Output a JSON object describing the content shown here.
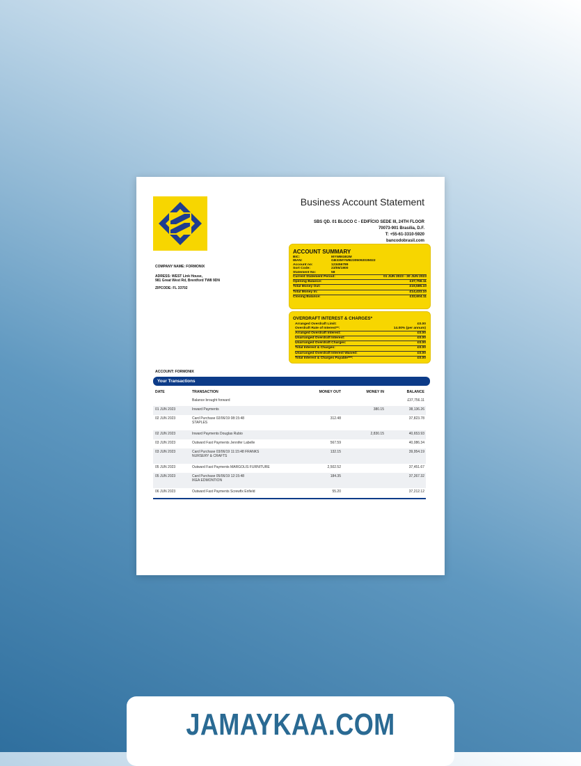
{
  "statement": {
    "title": "Business Account Statement",
    "bank_address": [
      "SBS QD. 01 BLOCO C - EDIFÍCIO SEDE III, 24TH FLOOR",
      "70073-901 Brasília, D.F.",
      "T: +55-61-3310-5920",
      "bancodobrasil.com"
    ],
    "company_name": "COMPANY NAME: FORMONIX",
    "address_line1": "ADRESS: WEST Link House,",
    "address_line2": "981 Great West Rd, Brentford TW8 9DN",
    "zipcode": "ZIPCODE: FL 33702",
    "brand_color": "#f7d600",
    "accent_color": "#0c3b88"
  },
  "summary": {
    "title": "ACCOUNT SUMMARY",
    "details": [
      {
        "label": "BIC:",
        "value": "MYWBGB2M"
      },
      {
        "label": "IBAN:",
        "value": "GB33MYWB2305092035022"
      },
      {
        "label": "Account no:",
        "value": "123456789"
      },
      {
        "label": "Sort Code:",
        "value": "23/05/1900"
      },
      {
        "label": "Statement No:",
        "value": "58"
      }
    ],
    "lines": [
      {
        "label": "Current Statement Period:",
        "value": "01 JUN 2023 - 30 JUN 2023"
      },
      {
        "label": "Opening Balance:",
        "value": "£37,756.11"
      },
      {
        "label": "Total Money Out:",
        "value": "£19,585.10"
      },
      {
        "label": "Total Money In:",
        "value": "£14,433.10"
      },
      {
        "label": "Closing Balance:",
        "value": "£32,604.11"
      }
    ]
  },
  "overdraft": {
    "title": "OVERDRAFT INTEREST & CHARGES*",
    "lines": [
      {
        "label": "Arranged Overdraft Limit:",
        "value": "£0.00"
      },
      {
        "label": "Overdraft Rate of Interest**:",
        "value": "14.00% (per annum)"
      },
      {
        "label": "Arranged Overdraft Interest:",
        "value": "£0.00"
      },
      {
        "label": "Unarranged Overdraft Interest:",
        "value": "£0.00"
      },
      {
        "label": "Unarranged Overdraft Charges:",
        "value": "£0.00"
      },
      {
        "label": "Total Interest & Charges:",
        "value": "£0.00"
      },
      {
        "label": "Unarranged Overdraft Interest Waived:",
        "value": "£0.00"
      },
      {
        "label": "Total Interest & Charges Payable***:",
        "value": "£0.00"
      }
    ]
  },
  "transactions": {
    "account_prefix": "ACCOUNT:",
    "account_name": "FORMONIX",
    "bar_label": "Your Transactions",
    "headers": {
      "date": "DATE",
      "transaction": "TRANSACTION",
      "money_out": "MONEY OUT",
      "money_in": "MONEY IN",
      "balance": "BALANCE"
    },
    "rows": [
      {
        "date": "",
        "desc1": "Balance brought forward",
        "desc2": "",
        "out": "",
        "in": "",
        "balance": "£37,756.11"
      },
      {
        "date": "01 JUN 2023",
        "desc1": "Inward Payments",
        "desc2": "",
        "out": "",
        "in": "380.15",
        "balance": "38,136.26"
      },
      {
        "date": "02 JUN 2023",
        "desc1": "Card Purchase 02/06/19 08:15:48",
        "desc2": "STAPLES",
        "out": "312.48",
        "in": "",
        "balance": "37,823.78"
      },
      {
        "date": "02 JUN 2023",
        "desc1": "Inward Payments Douglas Rubio",
        "desc2": "",
        "out": "",
        "in": "2,830.15",
        "balance": "40,653.93"
      },
      {
        "date": "03 JUN 2023",
        "desc1": "Outward Fast Payments Jennifer Labelle",
        "desc2": "",
        "out": "567.59",
        "in": "",
        "balance": "40,086.34"
      },
      {
        "date": "03 JUN 2023",
        "desc1": "Card Purchase 03/06/19 11:15:48 FRANKS",
        "desc2": "NURSERY & CRAFTS",
        "out": "132.15",
        "in": "",
        "balance": "39,954.19"
      },
      {
        "date": "05 JUN 2023",
        "desc1": "Outward Fast Payments MARGOLIS FURNITURE",
        "desc2": "",
        "out": "2,502.52",
        "in": "",
        "balance": "37,451.67"
      },
      {
        "date": "05 JUN 2023",
        "desc1": "Card Purchase 05/06/19 12:15:48",
        "desc2": "IKEA EDMONTION",
        "out": "184.35",
        "in": "",
        "balance": "37,267.32"
      },
      {
        "date": "06 JUN 2023",
        "desc1": "Outward Fast Payments Screwfix Enfield",
        "desc2": "",
        "out": "55.20",
        "in": "",
        "balance": "37,212.12"
      }
    ]
  },
  "watermark": {
    "text": "JAMAYKAA.COM"
  }
}
